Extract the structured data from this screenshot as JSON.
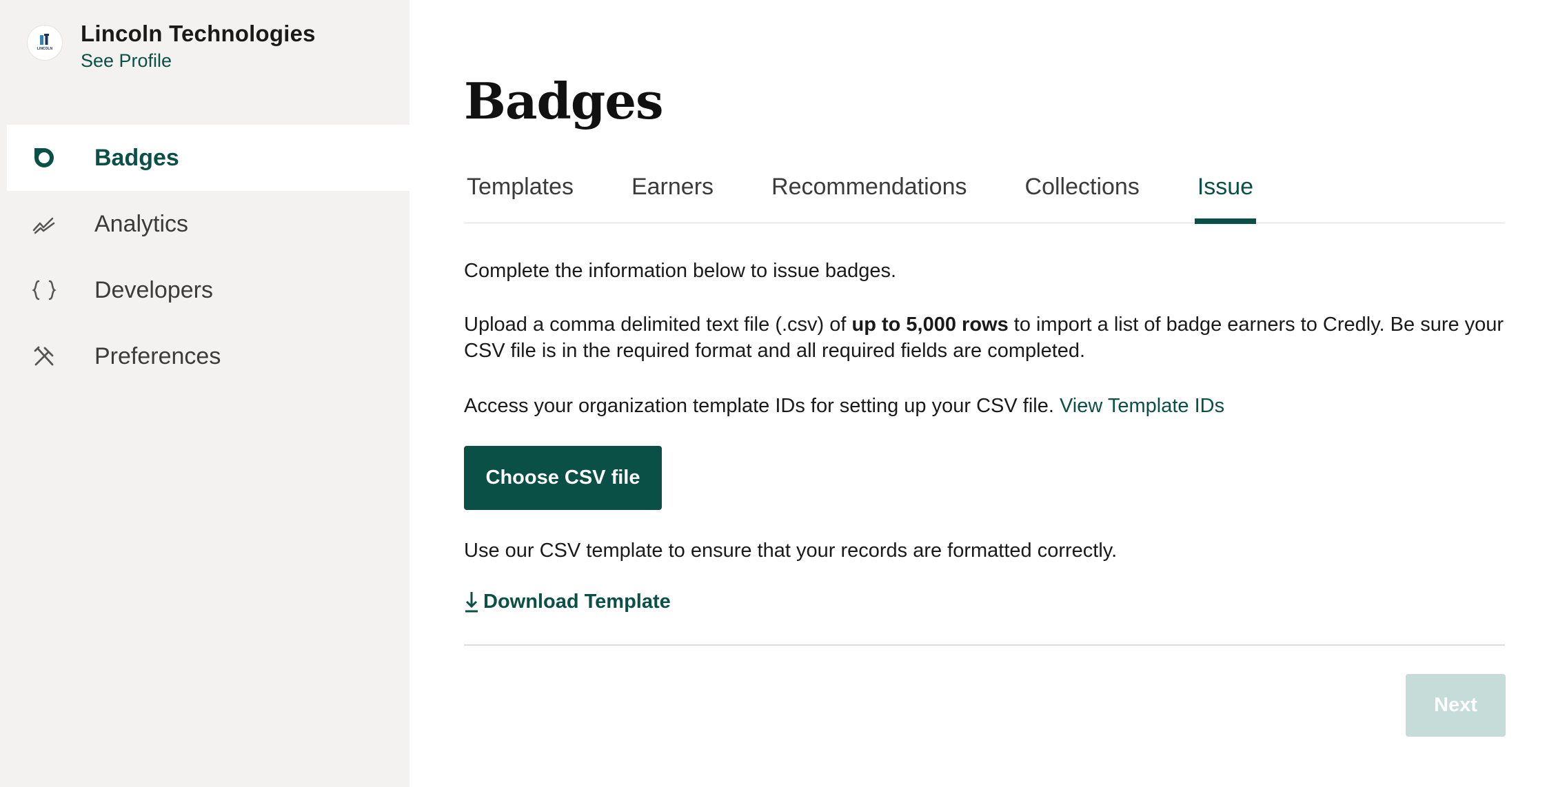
{
  "org": {
    "name": "Lincoln Technologies",
    "profile_link": "See Profile",
    "logo_text": "LINCOLN"
  },
  "sidebar": {
    "items": [
      {
        "label": "Badges",
        "icon": "badge-icon",
        "active": true
      },
      {
        "label": "Analytics",
        "icon": "analytics-icon",
        "active": false
      },
      {
        "label": "Developers",
        "icon": "braces-icon",
        "active": false
      },
      {
        "label": "Preferences",
        "icon": "tools-icon",
        "active": false
      }
    ]
  },
  "main": {
    "title": "Badges",
    "tabs": [
      {
        "label": "Templates",
        "active": false
      },
      {
        "label": "Earners",
        "active": false
      },
      {
        "label": "Recommendations",
        "active": false
      },
      {
        "label": "Collections",
        "active": false
      },
      {
        "label": "Issue",
        "active": true
      }
    ],
    "intro": "Complete the information below to issue badges.",
    "upload_text_before": "Upload a comma delimited text file (.csv) of ",
    "upload_text_bold": "up to 5,000 rows",
    "upload_text_after": " to import a list of badge earners to Credly. Be sure your CSV file is in the required format and all required fields are completed.",
    "access_text": "Access your organization template IDs for setting up your CSV file. ",
    "view_template_ids": "View Template IDs",
    "choose_csv_label": "Choose CSV file",
    "template_hint": "Use our CSV template to ensure that your records are formatted correctly.",
    "download_label": "Download Template",
    "next_label": "Next"
  },
  "colors": {
    "accent": "#0b5047",
    "sidebar_bg": "#f3f2f0",
    "next_disabled": "#c6dcd8"
  }
}
